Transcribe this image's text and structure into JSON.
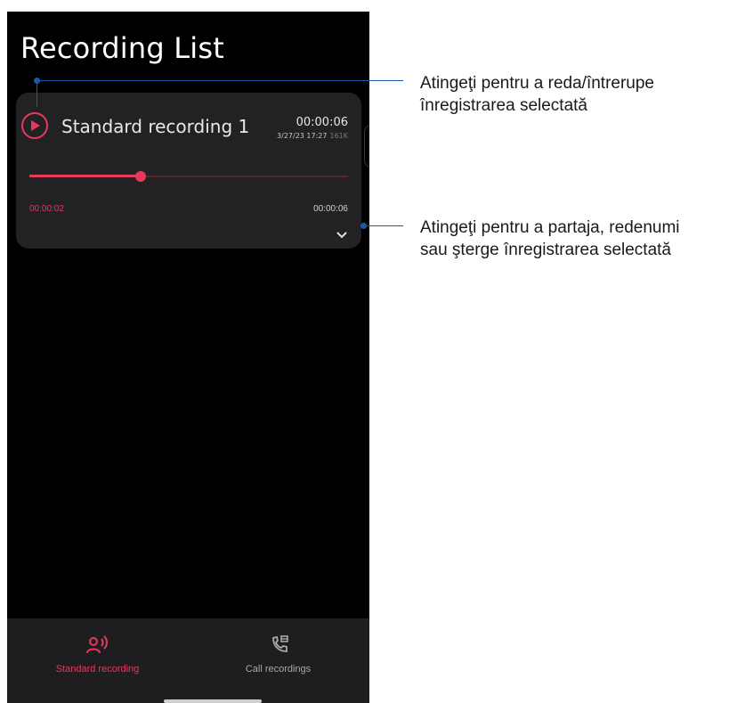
{
  "header": {
    "title": "Recording List"
  },
  "recording": {
    "name": "Standard recording 1",
    "duration": "00:00:06",
    "datetime": "3/27/23 17:27",
    "size": "161K",
    "elapsed": "00:00:02",
    "total": "00:00:06",
    "progress_fraction": 0.35
  },
  "bottom_nav": {
    "standard_label": "Standard recording",
    "call_label": "Call recordings"
  },
  "callouts": {
    "play": {
      "line1": "Atingeţi pentru a reda/întrerupe",
      "line2": "înregistrarea selectată"
    },
    "expand": {
      "line1": "Atingeţi pentru a partaja, redenumi",
      "line2": "sau şterge înregistrarea selectată"
    }
  },
  "colors": {
    "accent": "#e8395c",
    "background": "#000000",
    "card": "#222224",
    "callout": "#1a5aa8"
  },
  "icons": {
    "play": "play-icon",
    "expand": "chevron-down-icon",
    "standard": "voice-recording-icon",
    "call": "call-recording-icon"
  }
}
